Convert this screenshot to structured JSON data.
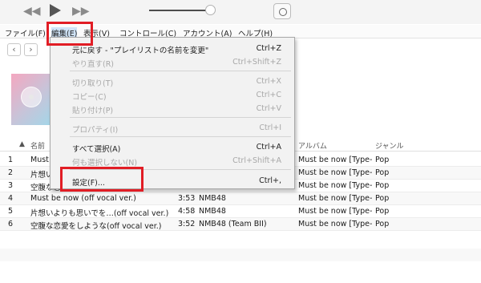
{
  "player": {
    "rewind_icon": "rewind-icon",
    "play_icon": "play-icon",
    "forward_icon": "fast-forward-icon",
    "volume_level": 0.9,
    "airplay_icon": "airplay-icon"
  },
  "menubar": {
    "file": "ファイル(F)",
    "edit": "編集(E)",
    "view": "表示(V)",
    "controls": "コントロール(C)",
    "account": "アカウント(A)",
    "help": "ヘルプ(H)"
  },
  "nav": {
    "back": "‹",
    "forward": "›"
  },
  "table": {
    "headers": {
      "num": "",
      "name": "名前",
      "artist_col": "アルバム",
      "genre": "ジャンル"
    },
    "rows": [
      {
        "num": "1",
        "name": "Must be now",
        "time": "",
        "artist": "",
        "album": "Must be now [Type-C]",
        "genre": "Pop"
      },
      {
        "num": "2",
        "name": "片想いよりも思いでを…",
        "time": "",
        "artist": "",
        "album": "Must be now [Type-C]",
        "genre": "Pop"
      },
      {
        "num": "3",
        "name": "空腹な恋愛をしような",
        "time": "",
        "artist": "",
        "album": "Must be now [Type-C]",
        "genre": "Pop"
      },
      {
        "num": "4",
        "name": "Must be now (off vocal ver.)",
        "time": "3:53",
        "artist": "NMB48",
        "album": "Must be now [Type-C]",
        "genre": "Pop"
      },
      {
        "num": "5",
        "name": "片想いよりも思いでを…(off vocal ver.)",
        "time": "4:58",
        "artist": "NMB48",
        "album": "Must be now [Type-C]",
        "genre": "Pop"
      },
      {
        "num": "6",
        "name": "空腹な恋愛をしような(off vocal ver.)",
        "time": "3:52",
        "artist": "NMB48 (Team BII)",
        "album": "Must be now [Type-C]",
        "genre": "Pop"
      }
    ]
  },
  "edit_menu": {
    "items": [
      {
        "label": "元に戻す - \"プレイリストの名前を変更\"",
        "shortcut": "Ctrl+Z",
        "disabled": false
      },
      {
        "label": "やり直す(R)",
        "shortcut": "Ctrl+Shift+Z",
        "disabled": true
      },
      {
        "label": "切り取り(T)",
        "shortcut": "Ctrl+X",
        "disabled": true
      },
      {
        "label": "コピー(C)",
        "shortcut": "Ctrl+C",
        "disabled": true
      },
      {
        "label": "貼り付け(P)",
        "shortcut": "Ctrl+V",
        "disabled": true
      },
      {
        "label": "プロパティ(I)",
        "shortcut": "Ctrl+I",
        "disabled": true
      },
      {
        "label": "すべて選択(A)",
        "shortcut": "Ctrl+A",
        "disabled": false
      },
      {
        "label": "何も選択しない(N)",
        "shortcut": "Ctrl+Shift+A",
        "disabled": true
      },
      {
        "label": "設定(F)...",
        "shortcut": "Ctrl+,",
        "disabled": false
      }
    ]
  },
  "colors": {
    "highlight": "#e11d25",
    "menu_bg": "#f2f2f2",
    "disabled_text": "#a8a8a8"
  }
}
